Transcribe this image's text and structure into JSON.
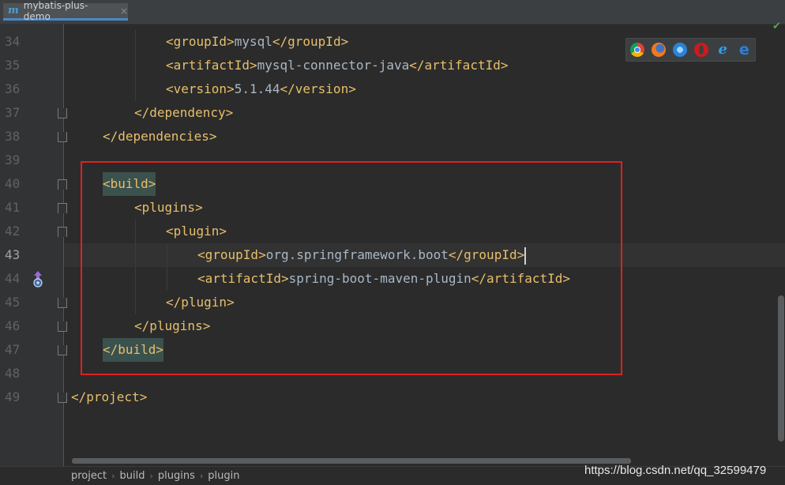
{
  "tab": {
    "icon": "m",
    "label": "mybatis-plus-demo",
    "close": "×"
  },
  "status_check": "✔",
  "gutter": {
    "lines": [
      "34",
      "35",
      "36",
      "37",
      "38",
      "39",
      "40",
      "41",
      "42",
      "43",
      "44",
      "45",
      "46",
      "47",
      "48",
      "49"
    ],
    "current_line": "43"
  },
  "code": {
    "l34": {
      "open": "<groupId>",
      "text": "mysql",
      "close": "</groupId>"
    },
    "l35": {
      "open": "<artifactId>",
      "text": "mysql-connector-java",
      "close": "</artifactId>"
    },
    "l36": {
      "open": "<version>",
      "text": "5.1.44",
      "close": "</version>"
    },
    "l37": {
      "tag": "</dependency>"
    },
    "l38": {
      "tag": "</dependencies>"
    },
    "l40": {
      "tag": "<build>"
    },
    "l41": {
      "tag": "<plugins>"
    },
    "l42": {
      "tag": "<plugin>"
    },
    "l43": {
      "open": "<groupId>",
      "text": "org.springframework.boot",
      "close": "</groupId>"
    },
    "l44": {
      "open": "<artifactId>",
      "text": "spring-boot-maven-plugin",
      "close": "</artifactId>"
    },
    "l45": {
      "tag": "</plugin>"
    },
    "l46": {
      "tag": "</plugins>"
    },
    "l47": {
      "tag": "</build>"
    },
    "l49": {
      "tag": "</project>"
    }
  },
  "browser_icons": [
    "chrome-icon",
    "firefox-icon",
    "safari-icon",
    "opera-icon",
    "ie-icon",
    "edge-icon"
  ],
  "ie_glyph": "e",
  "edge_glyph": "e",
  "breadcrumb": [
    "project",
    "build",
    "plugins",
    "plugin"
  ],
  "breadcrumb_sep": "›",
  "watermark": "https://blog.csdn.net/qq_32599479",
  "colors": {
    "background": "#2b2b2b",
    "tag": "#e8bf6a",
    "text": "#a9b7c6",
    "annotation": "#e02020",
    "tab_accent": "#4a88c7"
  }
}
